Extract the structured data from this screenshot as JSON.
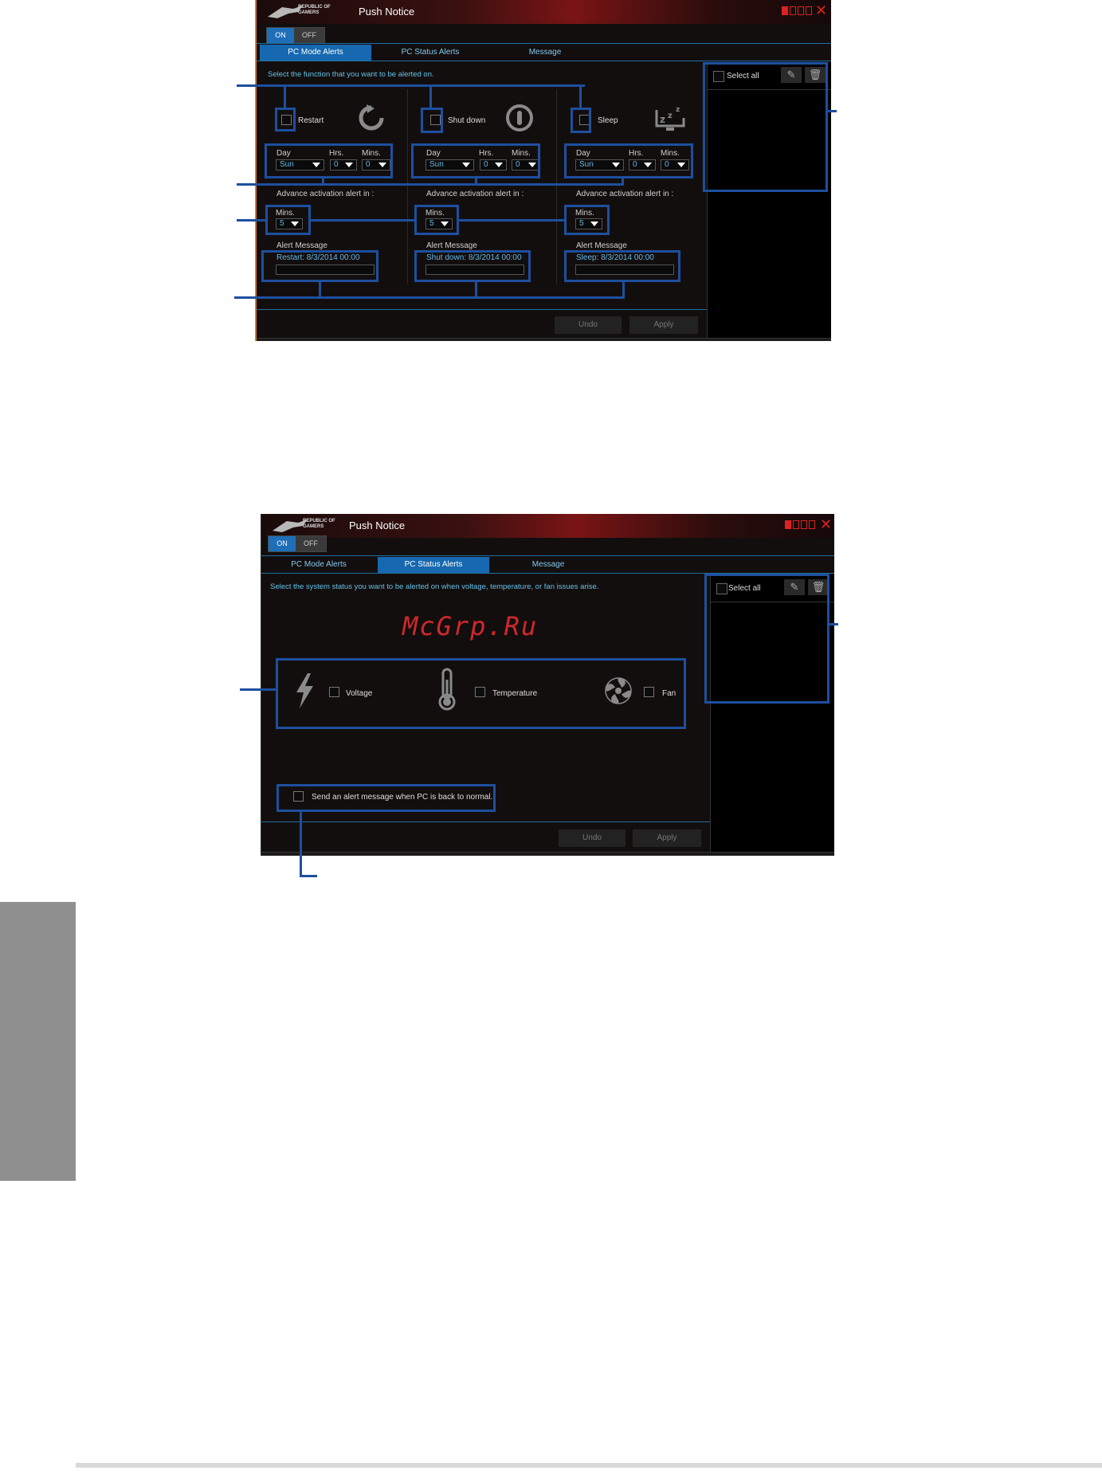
{
  "window1": {
    "app_title": "Push Notice",
    "logo_text": "REPUBLIC OF GAMERS",
    "toggle_on": "ON",
    "toggle_off": "OFF",
    "tabs": [
      "PC Mode Alerts",
      "PC Status Alerts",
      "Message"
    ],
    "active_tab": "PC Mode Alerts",
    "instruction": "Select the function that you want to be alerted on.",
    "select_all": "Select all",
    "functions": [
      {
        "label": "Restart",
        "day_label": "Day",
        "hrs_label": "Hrs.",
        "mins_label": "Mins.",
        "day": "Sun",
        "hrs": "0",
        "mins": "0",
        "advance_label": "Advance activation alert in :",
        "advance_mins_label": "Mins.",
        "advance_mins": "5",
        "alert_msg_label": "Alert Message",
        "alert_msg": "Restart: 8/3/2014 00:00"
      },
      {
        "label": "Shut down",
        "day_label": "Day",
        "hrs_label": "Hrs.",
        "mins_label": "Mins.",
        "day": "Sun",
        "hrs": "0",
        "mins": "0",
        "advance_label": "Advance activation alert in :",
        "advance_mins_label": "Mins.",
        "advance_mins": "5",
        "alert_msg_label": "Alert Message",
        "alert_msg": "Shut down: 8/3/2014 00:00"
      },
      {
        "label": "Sleep",
        "day_label": "Day",
        "hrs_label": "Hrs.",
        "mins_label": "Mins.",
        "day": "Sun",
        "hrs": "0",
        "mins": "0",
        "advance_label": "Advance activation alert in :",
        "advance_mins_label": "Mins.",
        "advance_mins": "5",
        "alert_msg_label": "Alert Message",
        "alert_msg": "Sleep: 8/3/2014 00:00"
      }
    ],
    "undo": "Undo",
    "apply": "Apply"
  },
  "window2": {
    "app_title": "Push Notice",
    "logo_text": "REPUBLIC OF GAMERS",
    "toggle_on": "ON",
    "toggle_off": "OFF",
    "tabs": [
      "PC Mode Alerts",
      "PC Status Alerts",
      "Message"
    ],
    "active_tab": "PC Status Alerts",
    "instruction": "Select the system status you want to be alerted on when voltage, temperature, or fan issues arise.",
    "select_all": "Select all",
    "status_items": [
      "Voltage",
      "Temperature",
      "Fan"
    ],
    "back_to_normal": "Send an alert message when PC is back to normal.",
    "undo": "Undo",
    "apply": "Apply"
  },
  "watermark": "McGrp.Ru",
  "colors": {
    "accent_blue": "#1668b0",
    "callout_blue": "#1d4f9e",
    "window_bg": "#130e0e",
    "title_red": "#7a1414",
    "text_cyan": "#62c1e6",
    "side_tab_gray": "#8f8f8f"
  }
}
